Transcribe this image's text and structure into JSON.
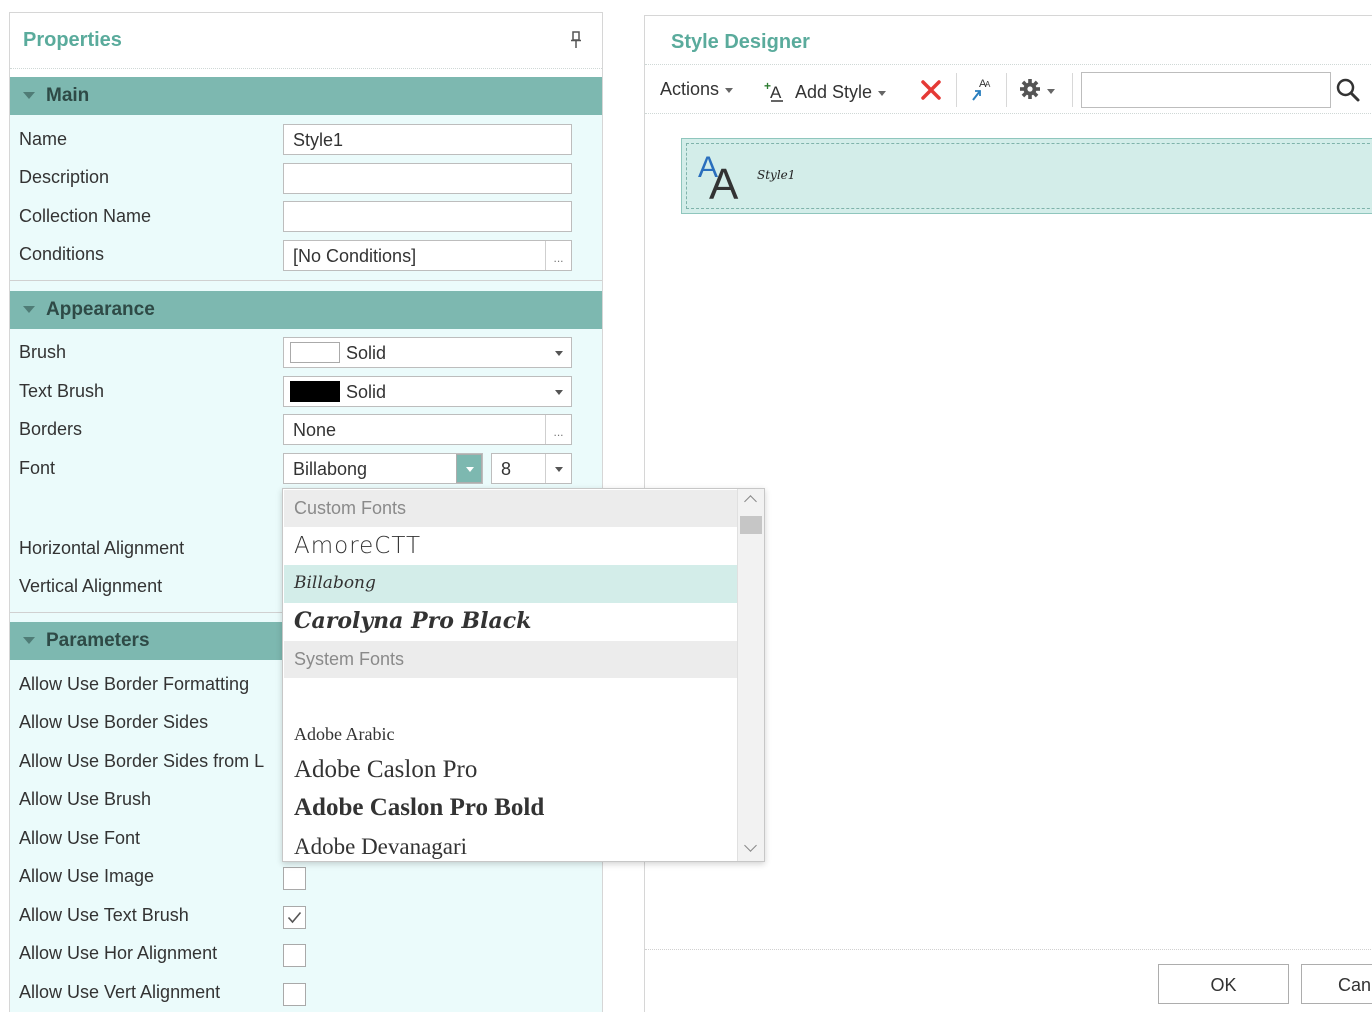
{
  "properties": {
    "title": "Properties",
    "sections": {
      "main": "Main",
      "appearance": "Appearance",
      "parameters": "Parameters"
    },
    "main": {
      "name_label": "Name",
      "name_value": "Style1",
      "description_label": "Description",
      "description_value": "",
      "collection_label": "Collection Name",
      "collection_value": "",
      "conditions_label": "Conditions",
      "conditions_value": "[No Conditions]"
    },
    "appearance": {
      "brush_label": "Brush",
      "brush_value": "Solid",
      "brush_color": "#ffffff",
      "text_brush_label": "Text Brush",
      "text_brush_value": "Solid",
      "text_brush_color": "#000000",
      "borders_label": "Borders",
      "borders_value": "None",
      "font_label": "Font",
      "font_value": "Billabong",
      "font_size": "8",
      "halign_label": "Horizontal Alignment",
      "valign_label": "Vertical Alignment"
    },
    "parameters": [
      {
        "label": "Allow Use Border Formatting"
      },
      {
        "label": "Allow Use Border Sides"
      },
      {
        "label": "Allow Use Border Sides from L"
      },
      {
        "label": "Allow Use Brush"
      },
      {
        "label": "Allow Use Font"
      },
      {
        "label": "Allow Use Image",
        "checked": false
      },
      {
        "label": "Allow Use Text Brush",
        "checked": true
      },
      {
        "label": "Allow Use Hor Alignment",
        "checked": false
      },
      {
        "label": "Allow Use Vert Alignment",
        "checked": false
      }
    ]
  },
  "font_dropdown": {
    "custom_group": "Custom Fonts",
    "custom_fonts": [
      "AmoreCTT",
      "Billabong",
      "Carolyna Pro Black"
    ],
    "selected": "Billabong",
    "system_group": "System Fonts",
    "system_fonts": [
      "",
      "Adobe Arabic",
      "Adobe Caslon Pro",
      "Adobe Caslon Pro Bold",
      "Adobe Devanagari"
    ]
  },
  "designer": {
    "title": "Style Designer",
    "toolbar": {
      "actions_label": "Actions",
      "add_style_label": "Add Style",
      "search_value": ""
    },
    "style_item_name": "Style1",
    "ok_label": "OK",
    "cancel_label": "Can"
  },
  "colors": {
    "accent": "#5aab9c",
    "section_bg": "#7db8b0",
    "panel_bg": "#ebfbfb",
    "selected_bg": "#d3ede9",
    "delete_red": "#e53935"
  }
}
